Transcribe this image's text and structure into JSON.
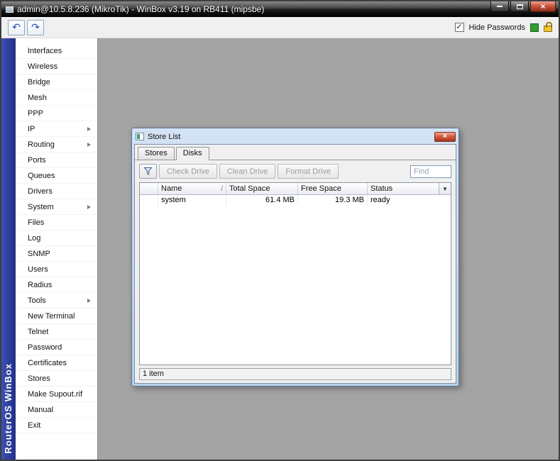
{
  "window": {
    "title": "admin@10.5.8.236 (MikroTik) - WinBox v3.19 on RB411 (mipsbe)"
  },
  "toolbar": {
    "undo_glyph": "↶",
    "redo_glyph": "↷",
    "check_glyph": "✓",
    "hide_passwords_label": "Hide Passwords",
    "hide_passwords_checked": true
  },
  "sidebar": {
    "brand": "RouterOS WinBox",
    "items": [
      {
        "label": "Interfaces"
      },
      {
        "label": "Wireless"
      },
      {
        "label": "Bridge"
      },
      {
        "label": "Mesh"
      },
      {
        "label": "PPP"
      },
      {
        "label": "IP",
        "submenu": true
      },
      {
        "label": "Routing",
        "submenu": true
      },
      {
        "label": "Ports"
      },
      {
        "label": "Queues"
      },
      {
        "label": "Drivers"
      },
      {
        "label": "System",
        "submenu": true
      },
      {
        "label": "Files"
      },
      {
        "label": "Log"
      },
      {
        "label": "SNMP"
      },
      {
        "label": "Users"
      },
      {
        "label": "Radius"
      },
      {
        "label": "Tools",
        "submenu": true
      },
      {
        "label": "New Terminal"
      },
      {
        "label": "Telnet"
      },
      {
        "label": "Password"
      },
      {
        "label": "Certificates"
      },
      {
        "label": "Stores"
      },
      {
        "label": "Make Supout.rif"
      },
      {
        "label": "Manual"
      },
      {
        "label": "Exit"
      }
    ]
  },
  "store_window": {
    "title": "Store List",
    "close_glyph": "×",
    "tabs": [
      {
        "label": "Stores",
        "active": false
      },
      {
        "label": "Disks",
        "active": true
      }
    ],
    "buttons": [
      {
        "label": "Check Drive",
        "enabled": false
      },
      {
        "label": "Clean Drive",
        "enabled": false
      },
      {
        "label": "Format Drive",
        "enabled": false
      }
    ],
    "find_placeholder": "Find",
    "table": {
      "columns": [
        "Name",
        "Total Space",
        "Free Space",
        "Status"
      ],
      "sort_indicator": "/",
      "dropdown_glyph": "▼",
      "rows": [
        [
          "system",
          "61.4 MB",
          "19.3 MB",
          "ready"
        ]
      ]
    },
    "status": "1 item"
  }
}
